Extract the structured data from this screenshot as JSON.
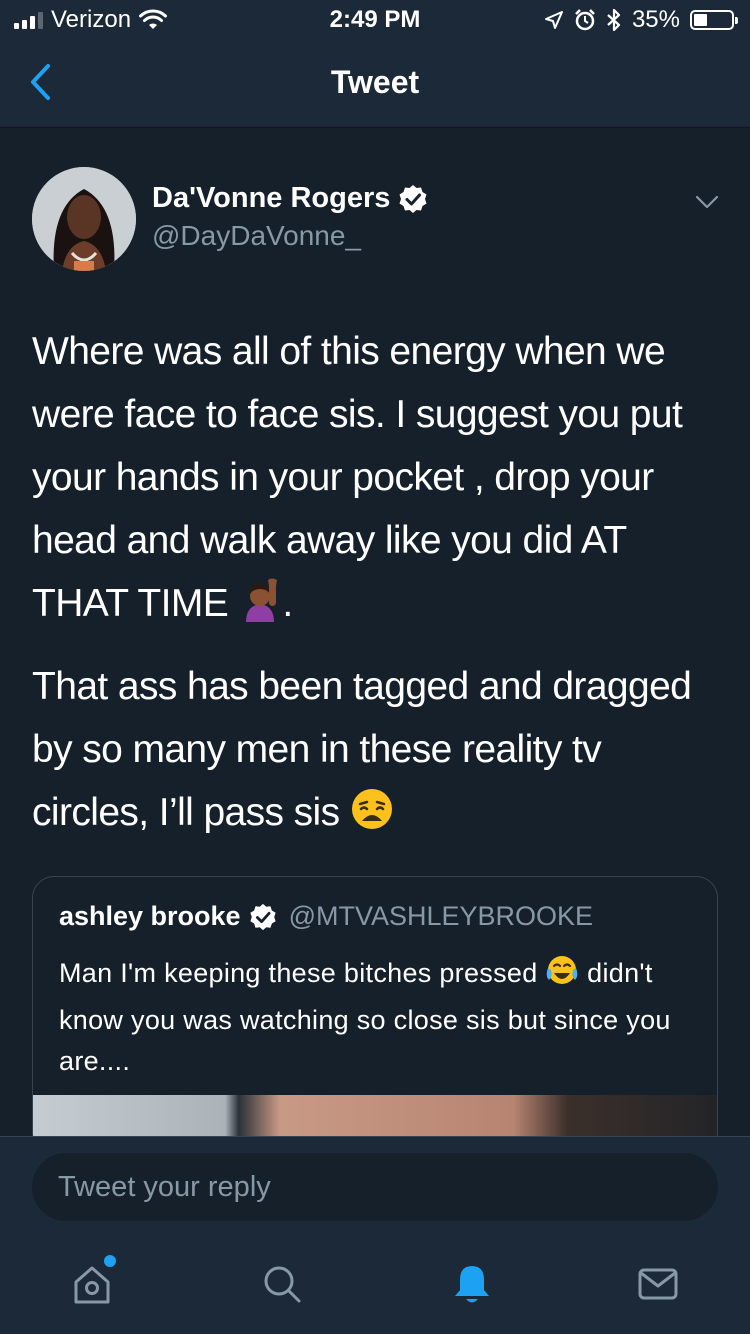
{
  "status_bar": {
    "carrier": "Verizon",
    "time": "2:49 PM",
    "battery_text": "35%",
    "battery_level": 0.35
  },
  "nav": {
    "title": "Tweet",
    "back_icon": "chevron-left-icon"
  },
  "tweet": {
    "author_name": "Da'Vonne Rogers",
    "author_handle": "@DayDaVonne_",
    "verified": true,
    "paragraph1": "Where was all of this energy when we were face to face sis. I suggest you put your hands in your pocket , drop your head and walk away like you did AT THAT TIME",
    "paragraph1_end": ".",
    "paragraph2": "That ass has been tagged and dragged by so many men in these reality tv circles, I’ll pass sis",
    "emoji1": "raising-hand-emoji",
    "emoji2": "weary-face-emoji"
  },
  "quote": {
    "name": "ashley brooke",
    "handle": "@MTVASHLEYBROOKE",
    "verified": true,
    "text_line1": "Man I'm keeping these bitches pressed",
    "text_rest": "didn't know you was watching so close sis but since you are....",
    "emoji": "tears-of-joy-emoji"
  },
  "reply": {
    "placeholder": "Tweet your reply"
  },
  "tabs": [
    {
      "name": "home",
      "icon": "home-icon"
    },
    {
      "name": "search",
      "icon": "search-icon"
    },
    {
      "name": "notifications",
      "icon": "bell-icon"
    },
    {
      "name": "messages",
      "icon": "envelope-icon"
    }
  ],
  "colors": {
    "background": "#15202b",
    "bar": "#1c2938",
    "accent": "#1da1f2",
    "secondary_text": "#8899a6"
  }
}
